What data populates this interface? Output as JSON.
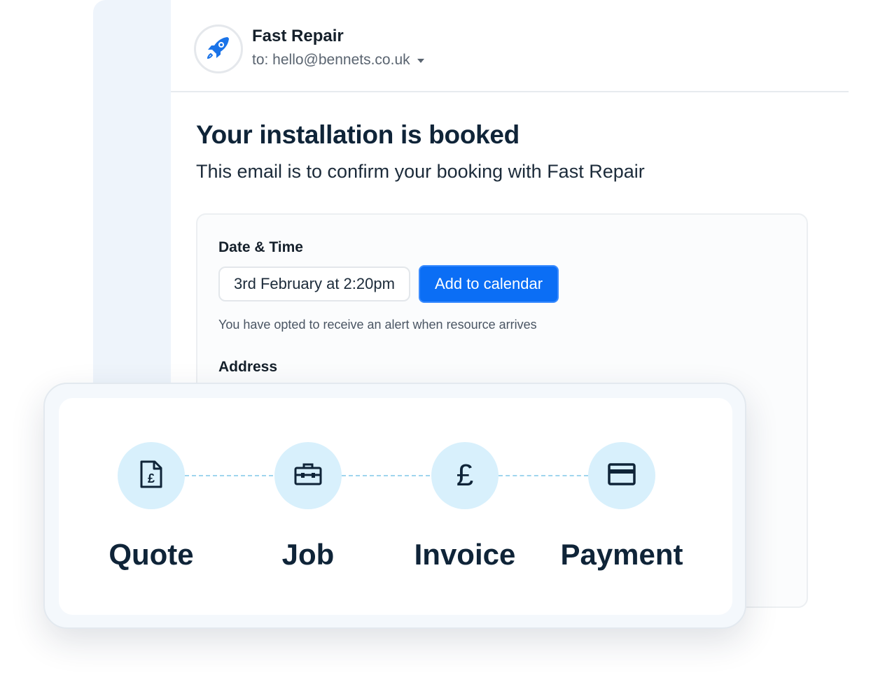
{
  "email": {
    "sender_name": "Fast Repair",
    "recipient": "to: hello@bennets.co.uk",
    "avatar_icon": "rocket-icon",
    "title": "Your installation is booked",
    "subtitle": "This email is to confirm your booking with Fast Repair",
    "booking": {
      "date_time_label": "Date & Time",
      "date_time_value": "3rd February at 2:20pm",
      "calendar_button": "Add to calendar",
      "alert_note": "You have opted to receive an alert when resource arrives",
      "address_label": "Address"
    }
  },
  "workflow": {
    "steps": [
      {
        "label": "Quote",
        "icon": "quote-document-icon"
      },
      {
        "label": "Job",
        "icon": "toolbox-icon"
      },
      {
        "label": "Invoice",
        "icon": "pound-icon"
      },
      {
        "label": "Payment",
        "icon": "card-icon"
      }
    ]
  },
  "colors": {
    "accent": "#0b6ef5",
    "text_dark": "#0f2438",
    "step_circle": "#d8f0fc",
    "connector": "#9fd5ee"
  }
}
